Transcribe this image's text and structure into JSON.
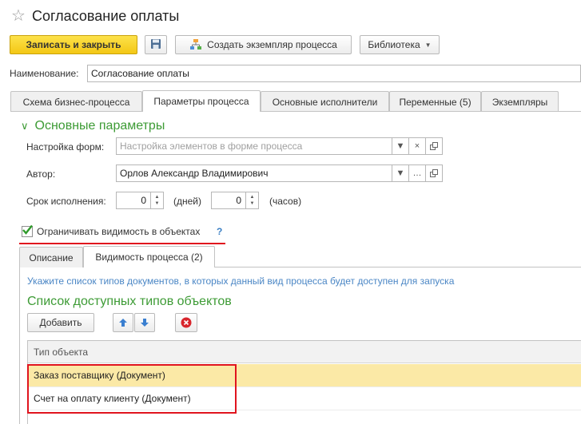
{
  "window": {
    "title": "Согласование оплаты"
  },
  "toolbar": {
    "save_close": "Записать и закрыть",
    "create_instance": "Создать экземпляр процесса",
    "library": "Библиотека"
  },
  "name_field": {
    "label": "Наименование:",
    "value": "Согласование оплаты"
  },
  "tabs": [
    {
      "label": "Схема бизнес-процесса"
    },
    {
      "label": "Параметры процесса",
      "active": true
    },
    {
      "label": "Основные исполнители"
    },
    {
      "label": "Переменные (5)"
    },
    {
      "label": "Экземпляры"
    }
  ],
  "main_params": {
    "title": "Основные параметры",
    "form_settings": {
      "label": "Настройка форм:",
      "placeholder": "Настройка элементов в форме процесса"
    },
    "author": {
      "label": "Автор:",
      "value": "Орлов Александр Владимирович"
    },
    "deadline": {
      "label": "Срок исполнения:",
      "days_value": "0",
      "days_unit": "(дней)",
      "hours_value": "0",
      "hours_unit": "(часов)"
    }
  },
  "restrict_visibility": {
    "label": "Ограничивать видимость в объектах",
    "checked": true,
    "help": "?"
  },
  "inner_tabs": [
    {
      "label": "Описание"
    },
    {
      "label": "Видимость процесса (2)",
      "active": true
    }
  ],
  "visibility": {
    "hint": "Укажите список типов документов, в которых данный вид процесса будет доступен для запуска",
    "list_title": "Список доступных типов объектов",
    "add_button": "Добавить",
    "table": {
      "header": "Тип объекта",
      "rows": [
        {
          "value": "Заказ поставщику (Документ)",
          "selected": true
        },
        {
          "value": "Счет на оплату клиенту (Документ)"
        }
      ]
    }
  },
  "colors": {
    "accent_green": "#3d9b35",
    "hint_blue": "#4a86c5",
    "primary_yellow": "#f3c715",
    "highlight": "#e0141e"
  }
}
